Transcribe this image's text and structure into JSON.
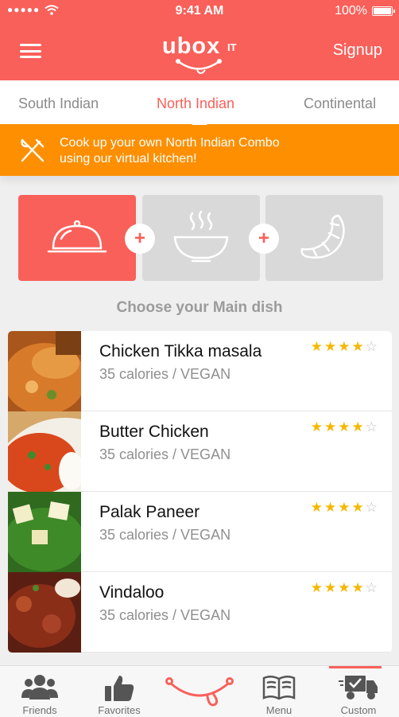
{
  "status_bar": {
    "time": "9:41 AM",
    "battery": "100%"
  },
  "header": {
    "logo": "UbOXIT",
    "logo_main": "ubox",
    "logo_sup": "IT",
    "signup_label": "Signup"
  },
  "tabs": [
    {
      "label": "South Indian",
      "active": false
    },
    {
      "label": "North Indian",
      "active": true
    },
    {
      "label": "Continental",
      "active": false
    }
  ],
  "banner": {
    "icon": "fork-knife-icon",
    "line1": "Cook up your own North Indian Combo",
    "line2": "using our virtual kitchen!"
  },
  "kitchen_steps": [
    {
      "icon": "cloche-icon",
      "active": true
    },
    {
      "icon": "soup-bowl-icon",
      "active": false
    },
    {
      "icon": "croissant-icon",
      "active": false
    }
  ],
  "section_title": "Choose your Main dish",
  "dishes": [
    {
      "name": "Chicken Tikka masala",
      "meta": "35 calories / VEGAN",
      "rating": 4,
      "rating_max": 5
    },
    {
      "name": "Butter Chicken",
      "meta": "35 calories / VEGAN",
      "rating": 4,
      "rating_max": 5
    },
    {
      "name": "Palak Paneer",
      "meta": "35 calories / VEGAN",
      "rating": 4,
      "rating_max": 5
    },
    {
      "name": "Vindaloo",
      "meta": "35 calories / VEGAN",
      "rating": 4,
      "rating_max": 5
    }
  ],
  "bottom_nav": [
    {
      "label": "Friends",
      "icon": "friends-icon"
    },
    {
      "label": "Favorites",
      "icon": "thumbs-up-icon"
    },
    {
      "label": "",
      "icon": "smile-logo-icon"
    },
    {
      "label": "Menu",
      "icon": "book-icon"
    },
    {
      "label": "Custom",
      "icon": "delivery-truck-icon",
      "active": true
    }
  ],
  "colors": {
    "brand": "#f9605a",
    "accent": "#fd8f00",
    "star": "#f5b800"
  }
}
